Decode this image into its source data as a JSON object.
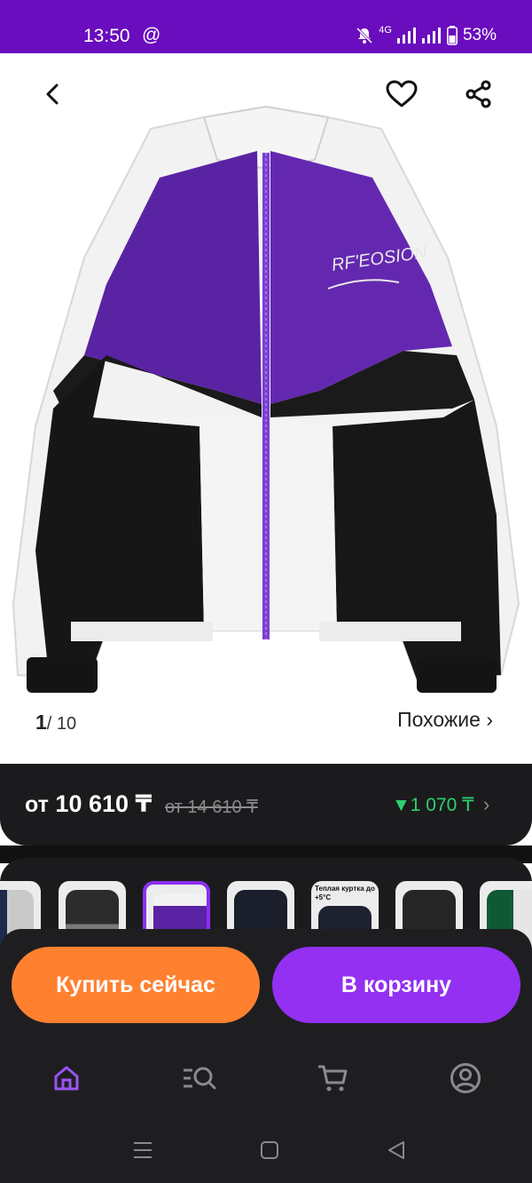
{
  "status_bar": {
    "time": "13:50",
    "at_symbol": "@",
    "network": "4G",
    "battery": "53%"
  },
  "product": {
    "image_alt": "Спортивная куртка фиолетово-бело-черная",
    "jacket_print": "RF'EOSION",
    "page_current": "1",
    "page_total": "/ 10",
    "similar": "Похожие ›"
  },
  "price": {
    "prefix": "от",
    "current": "10 610 ₸",
    "old": "от 14 610 ₸",
    "discount": "▼1 070 ₸",
    "chevron": "›"
  },
  "thumbnails": [
    {
      "caption": ""
    },
    {
      "caption": ""
    },
    {
      "caption": ""
    },
    {
      "caption": ""
    },
    {
      "caption": "Теплая куртка до +5°С"
    },
    {
      "caption": ""
    },
    {
      "caption": ""
    }
  ],
  "actions": {
    "buy_now": "Купить сейчас",
    "add_to_cart": "В корзину"
  },
  "tab_bar": {
    "items": [
      "home-icon",
      "catalog-search-icon",
      "cart-icon",
      "profile-icon"
    ],
    "active": "home-icon"
  },
  "colors": {
    "accent": "#9330f2",
    "buy": "#ff8130",
    "discount": "#2ed06e",
    "status": "#6a0dbe"
  }
}
